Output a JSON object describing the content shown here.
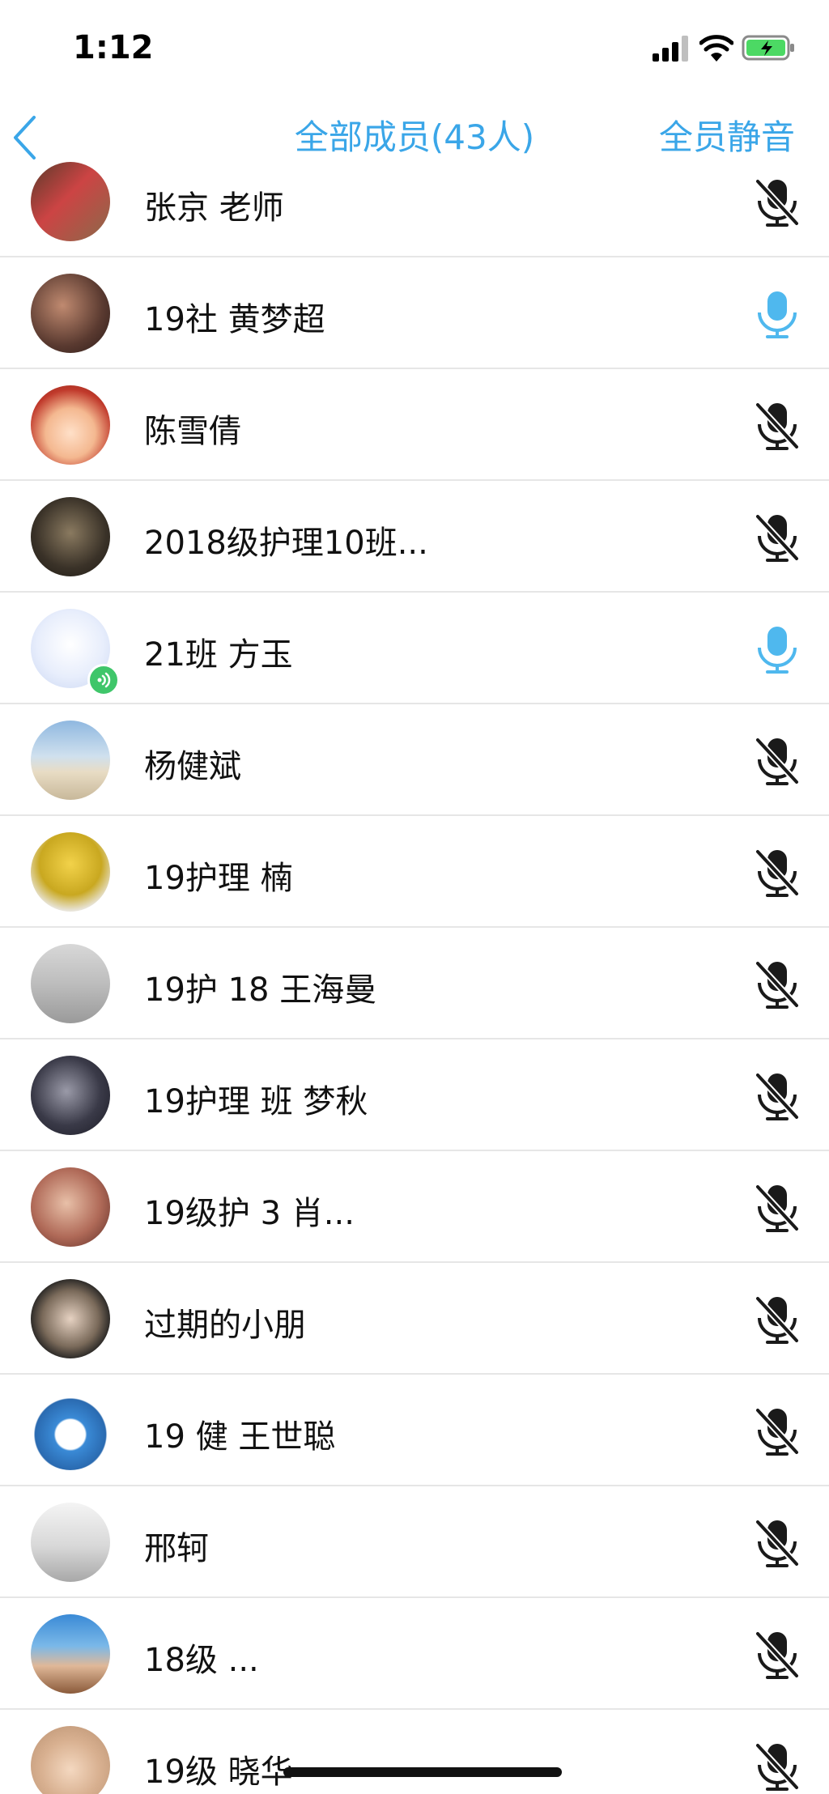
{
  "status_bar": {
    "time": "1:12"
  },
  "nav": {
    "back_icon": "chevron-left-icon",
    "title": "全部成员(43人)",
    "mute_all_label": "全员静音"
  },
  "colors": {
    "accent": "#3aa6e8",
    "mic_active": "#4fb8ee",
    "mic_muted": "#1a1a1a",
    "voice_badge": "#3fc66a",
    "divider": "#e6e6e6"
  },
  "members": [
    {
      "name": "张京 老师",
      "mic": "muted"
    },
    {
      "name": "19社 黄梦超",
      "mic": "active"
    },
    {
      "name": "陈雪倩",
      "mic": "muted"
    },
    {
      "name": "2018级护理10班...",
      "mic": "muted"
    },
    {
      "name": "21班 方玉",
      "mic": "active",
      "speaking": true
    },
    {
      "name": "杨健斌",
      "mic": "muted"
    },
    {
      "name": "19护理 楠",
      "mic": "muted"
    },
    {
      "name": "19护 18 王海曼",
      "mic": "muted"
    },
    {
      "name": "19护理 班 梦秋",
      "mic": "muted"
    },
    {
      "name": "19级护 3 肖...",
      "mic": "muted"
    },
    {
      "name": "过期的小朋",
      "mic": "muted"
    },
    {
      "name": "19 健 王世聪",
      "mic": "muted"
    },
    {
      "name": "邢轲",
      "mic": "muted"
    },
    {
      "name": "18级 ...",
      "mic": "muted"
    },
    {
      "name": "19级 晓华",
      "mic": "muted"
    }
  ]
}
